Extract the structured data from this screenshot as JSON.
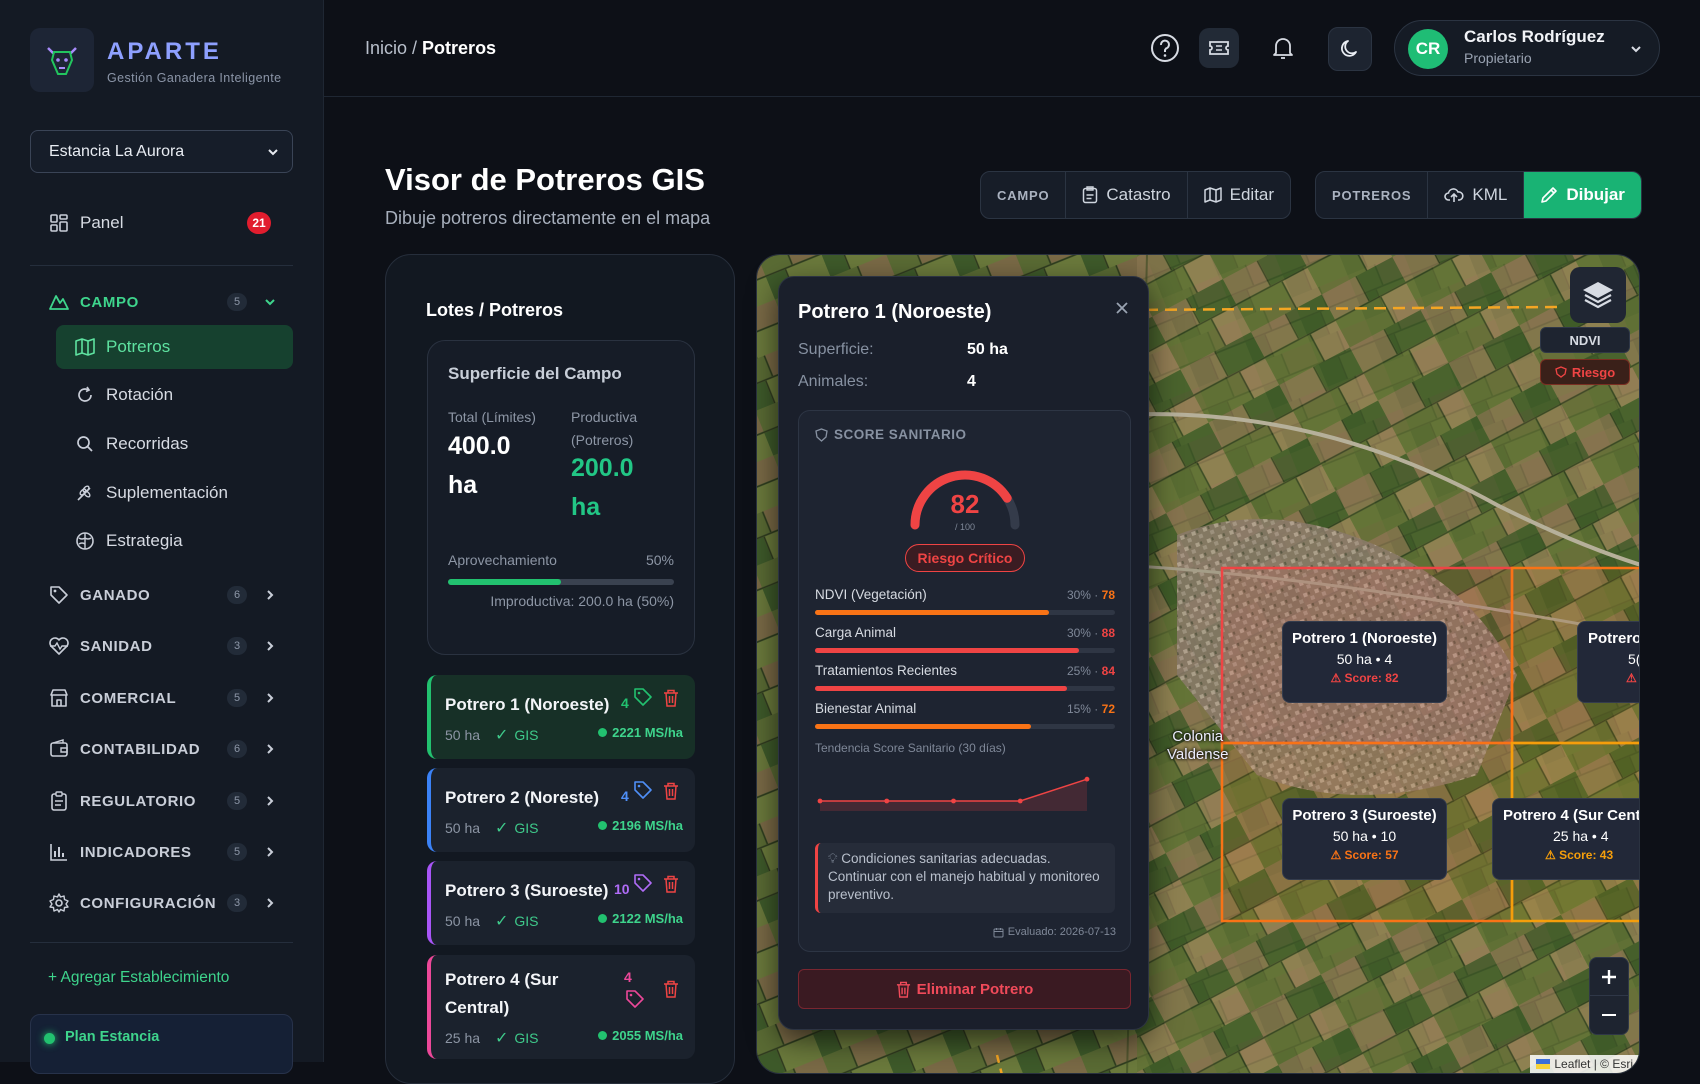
{
  "brand": {
    "name": "APARTE",
    "tagline": "Gestión Ganadera Inteligente"
  },
  "estancia": {
    "selected": "Estancia La Aurora"
  },
  "sidebar": {
    "panel": {
      "label": "Panel",
      "badge": "21"
    },
    "campo": {
      "label": "CAMPO",
      "count": "5"
    },
    "campo_items": [
      {
        "label": "Potreros",
        "icon": "map-icon"
      },
      {
        "label": "Rotación",
        "icon": "rotate-icon"
      },
      {
        "label": "Recorridas",
        "icon": "search-icon"
      },
      {
        "label": "Suplementación",
        "icon": "wheat-icon"
      },
      {
        "label": "Estrategia",
        "icon": "brain-icon"
      }
    ],
    "sections": [
      {
        "label": "GANADO",
        "count": "6",
        "icon": "tag-icon"
      },
      {
        "label": "SANIDAD",
        "count": "3",
        "icon": "heart-pulse-icon"
      },
      {
        "label": "COMERCIAL",
        "count": "5",
        "icon": "store-icon"
      },
      {
        "label": "CONTABILIDAD",
        "count": "6",
        "icon": "wallet-icon"
      },
      {
        "label": "REGULATORIO",
        "count": "5",
        "icon": "clipboard-icon"
      },
      {
        "label": "INDICADORES",
        "count": "5",
        "icon": "bar-chart-icon"
      },
      {
        "label": "CONFIGURACIÓN",
        "count": "3",
        "icon": "gear-icon"
      }
    ],
    "add_establishment": "+ Agregar Establecimiento",
    "plan": "Plan Estancia"
  },
  "header": {
    "breadcrumb_root": "Inicio /",
    "breadcrumb_current": "Potreros",
    "user": {
      "initials": "CR",
      "name": "Carlos Rodríguez",
      "role": "Propietario"
    }
  },
  "page": {
    "title": "Visor de Potreros GIS",
    "subtitle": "Dibuje potreros directamente en el mapa",
    "toolbar_campo": {
      "tag": "CAMPO",
      "catastro": "Catastro",
      "editar": "Editar"
    },
    "toolbar_potreros": {
      "tag": "POTREROS",
      "kml": "KML",
      "dibujar": "Dibujar"
    }
  },
  "lotes": {
    "title": "Lotes / Potreros",
    "surface": {
      "title": "Superficie del Campo",
      "total_label": "Total (Límites)",
      "total_value": "400.0",
      "total_unit": "ha",
      "prod_label": "Productiva",
      "prod_sub": "(Potreros)",
      "prod_value": "200.0",
      "prod_unit": "ha",
      "aprov_label": "Aprovechamiento",
      "aprov_pct": "50%",
      "aprov_fraction": 0.5,
      "improd": "Improductiva: 200.0 ha (50%)"
    },
    "potreros": [
      {
        "name": "Potrero 1 (Noroeste)",
        "count": "4",
        "ha": "50 ha",
        "gis": "GIS",
        "ms": "2221 MS/ha",
        "color": "#22c16f",
        "count_color": "#22c16f"
      },
      {
        "name": "Potrero 2 (Noreste)",
        "count": "4",
        "ha": "50 ha",
        "gis": "GIS",
        "ms": "2196 MS/ha",
        "color": "#3b82f6",
        "count_color": "#4f8ff7"
      },
      {
        "name": "Potrero 3 (Suroeste)",
        "count": "10",
        "ha": "50 ha",
        "gis": "GIS",
        "ms": "2122 MS/ha",
        "color": "#a855f7",
        "count_color": "#b06cf7"
      },
      {
        "name": "Potrero 4 (Sur Central)",
        "name_l1": "Potrero 4 (Sur",
        "name_l2": "Central)",
        "count": "4",
        "ha": "25 ha",
        "gis": "GIS",
        "ms": "2055 MS/ha",
        "color": "#ec4899",
        "count_color": "#ec4899"
      }
    ]
  },
  "popup": {
    "title": "Potrero 1 (Noroeste)",
    "superficie_label": "Superficie:",
    "superficie_value": "50 ha",
    "animales_label": "Animales:",
    "animales_value": "4",
    "score_label": "SCORE SANITARIO",
    "score": "82",
    "score_max": "/ 100",
    "score_fraction": 0.82,
    "risk": "Riesgo Crítico",
    "metrics": [
      {
        "name": "NDVI (Vegetación)",
        "weight": "30% ·",
        "value": "78",
        "fraction": 0.78,
        "color": "#f97316",
        "value_color": "#f97316"
      },
      {
        "name": "Carga Animal",
        "weight": "30% ·",
        "value": "88",
        "fraction": 0.88,
        "color": "#ef4444",
        "value_color": "#ef4444"
      },
      {
        "name": "Tratamientos Recientes",
        "weight": "25% ·",
        "value": "84",
        "fraction": 0.84,
        "color": "#ef4444",
        "value_color": "#ef4444"
      },
      {
        "name": "Bienestar Animal",
        "weight": "15% ·",
        "value": "72",
        "fraction": 0.72,
        "color": "#f97316",
        "value_color": "#f97316"
      }
    ],
    "trend_label": "Tendencia Score Sanitario (30 días)",
    "trend": [
      0,
      0,
      0,
      0,
      0.78
    ],
    "note": "Condiciones sanitarias adecuadas. Continuar con el manejo habitual y monitoreo preventivo.",
    "evaluated": "Evaluado: 2026-07-13",
    "delete": "Eliminar Potrero"
  },
  "map": {
    "ndvi": "NDVI",
    "riesgo": "Riesgo",
    "town": "Colonia Valdense",
    "town_l1": "Colonia",
    "town_l2": "Valdense",
    "labels": [
      {
        "name": "Potrero 1 (Noroeste)",
        "info": "50 ha • 4",
        "score": "⚠ Score: 82",
        "color": "#ef4444"
      },
      {
        "name": "Potrero 3 (Suroeste)",
        "info": "50 ha • 10",
        "score": "⚠ Score: 57",
        "color": "#f97316"
      },
      {
        "name": "Potrero 4 (Sur Cent",
        "info": "25 ha • 4",
        "score": "⚠ Score: 43",
        "color": "#f59e0b"
      },
      {
        "name": "Potrero",
        "info": "5(",
        "score": "⚠",
        "color": "#ef4444"
      }
    ],
    "attribution": "Leaflet | © Esri"
  }
}
